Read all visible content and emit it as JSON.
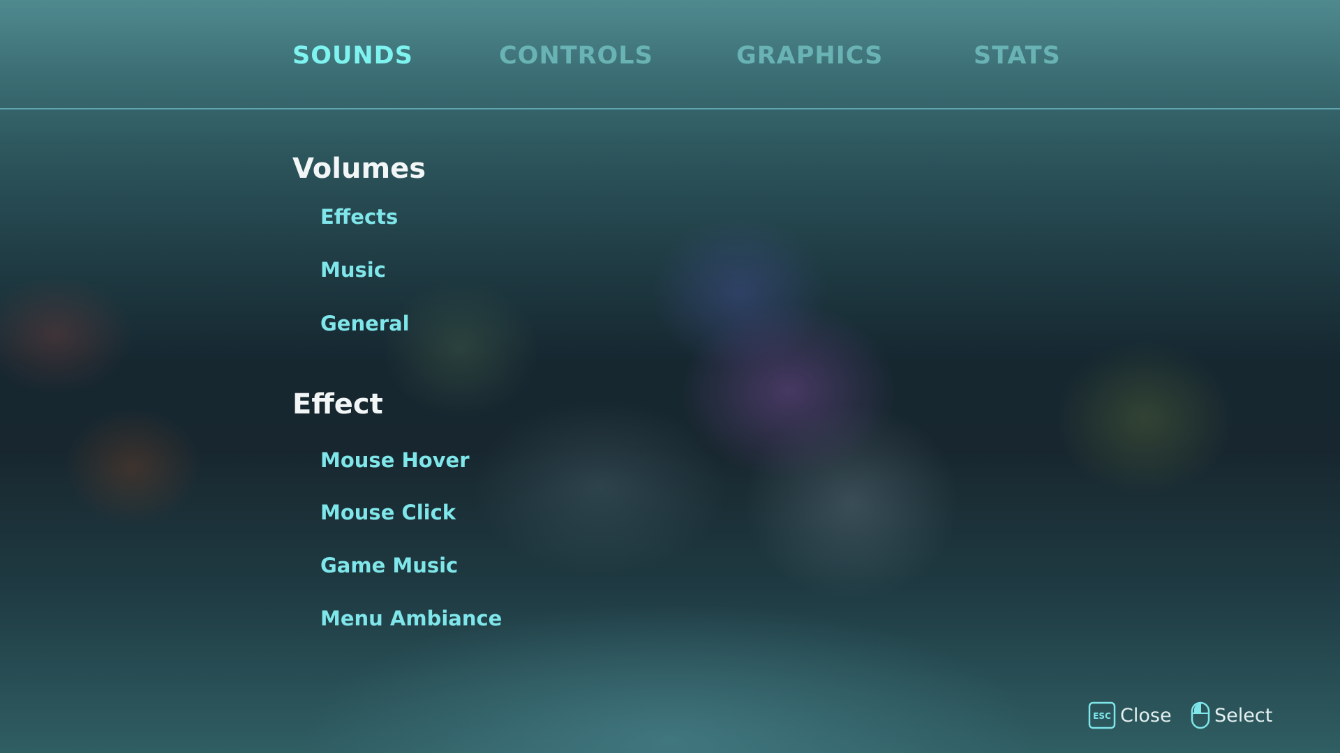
{
  "tabs": [
    {
      "label": "SOUNDS",
      "active": true
    },
    {
      "label": "CONTROLS",
      "active": false
    },
    {
      "label": "GRAPHICS",
      "active": false
    },
    {
      "label": "STATS",
      "active": false
    }
  ],
  "sections": {
    "volumes": {
      "title": "Volumes",
      "items": [
        "Effects",
        "Music",
        "General"
      ]
    },
    "effect": {
      "title": "Effect",
      "items": [
        "Mouse Hover",
        "Mouse Click",
        "Game Music",
        "Menu Ambiance"
      ]
    }
  },
  "footer": {
    "close": {
      "key": "ESC",
      "label": "Close",
      "icon": "esc-key-icon"
    },
    "select": {
      "label": "Select",
      "icon": "mouse-left-click-icon"
    }
  },
  "colors": {
    "tab_active": "#7ff3f0",
    "tab_inactive": "#6ab3b4",
    "item": "#7fe6ea",
    "heading": "#f2f6f6",
    "divider": "#6ebec3"
  }
}
